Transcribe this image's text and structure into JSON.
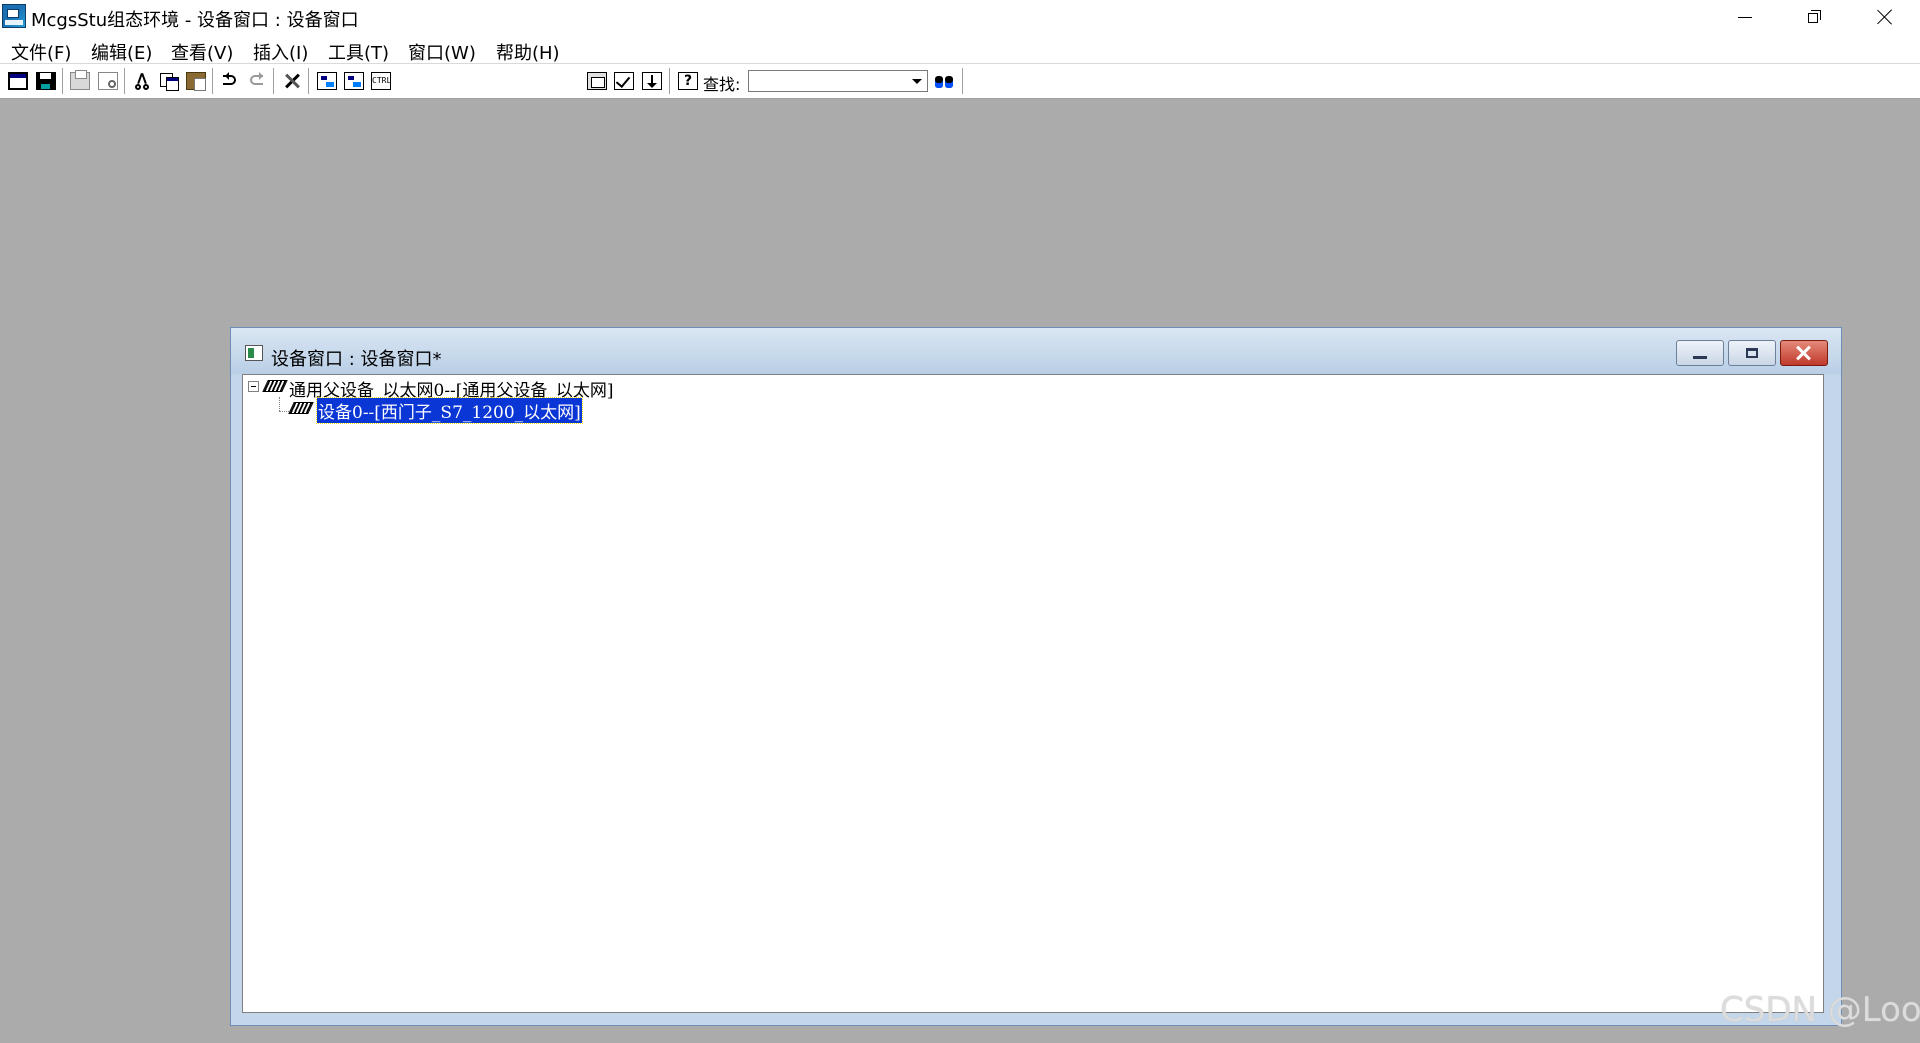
{
  "window": {
    "title": "McgsStu组态环境 - 设备窗口 : 设备窗口",
    "icon": "mcgs-app-icon"
  },
  "menu": [
    {
      "label": "文件(F)"
    },
    {
      "label": "编辑(E)"
    },
    {
      "label": "查看(V)"
    },
    {
      "label": "插入(I)"
    },
    {
      "label": "工具(T)"
    },
    {
      "label": "窗口(W)"
    },
    {
      "label": "帮助(H)"
    }
  ],
  "toolbar": {
    "find_label": "查找:",
    "find_value": "",
    "buttons": [
      "new-window-icon",
      "save-icon",
      "print-icon",
      "print-preview-icon",
      "cut-icon",
      "copy-icon",
      "paste-icon",
      "undo-icon",
      "redo-icon",
      "tools-icon",
      "device-tree-icon",
      "device-tree-2-icon",
      "ctrl-icon",
      "properties-icon",
      "check-icon",
      "download-icon",
      "help-icon",
      "find-icon"
    ]
  },
  "child_window": {
    "title": "设备窗口 : 设备窗口*",
    "tree": [
      {
        "label": "通用父设备_以太网0--[通用父设备_以太网]",
        "expanded": true
      },
      {
        "label": "设备0--[西门子_S7_1200_以太网]",
        "selected": true
      }
    ]
  },
  "watermark": "CSDN @Loo",
  "colors": {
    "desktop": "#ababab",
    "selection": "#0a36d6",
    "close_button": "#c0392b"
  }
}
